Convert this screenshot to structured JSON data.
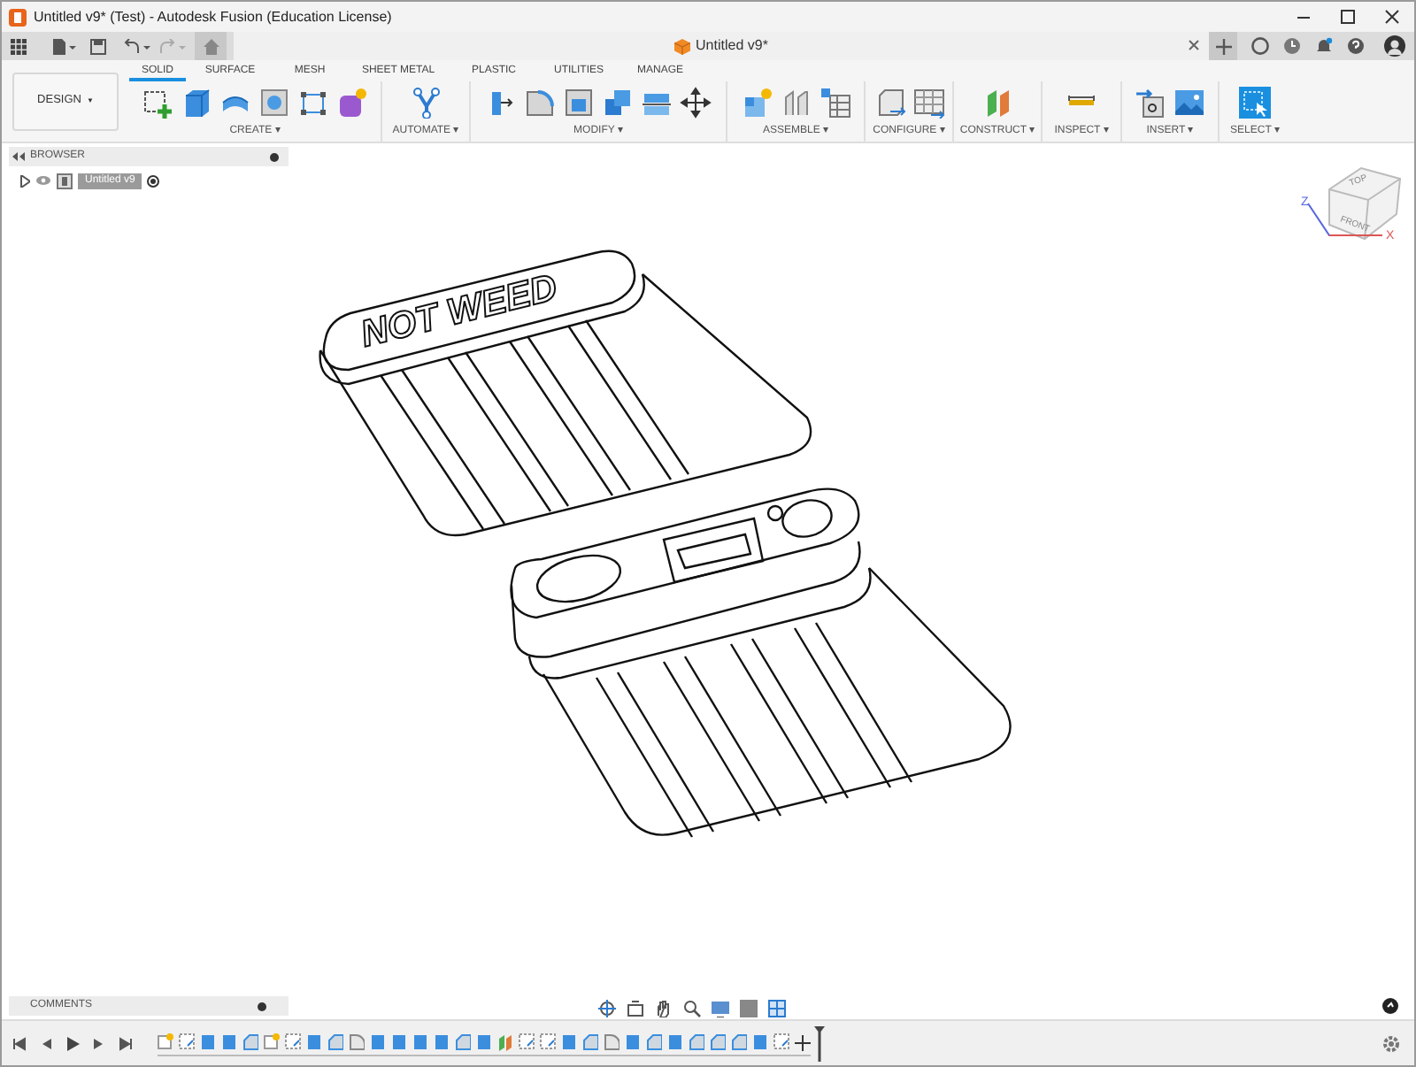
{
  "window": {
    "title": "Untitled v9* (Test) - Autodesk Fusion (Education License)"
  },
  "document_tab": {
    "title": "Untitled v9*"
  },
  "workspace_button": {
    "label": "DESIGN",
    "caret": "▼"
  },
  "ribbon_tabs": [
    {
      "label": "SOLID",
      "selected": true
    },
    {
      "label": "SURFACE",
      "selected": false
    },
    {
      "label": "MESH",
      "selected": false
    },
    {
      "label": "SHEET METAL",
      "selected": false
    },
    {
      "label": "PLASTIC",
      "selected": false
    },
    {
      "label": "UTILITIES",
      "selected": false
    },
    {
      "label": "MANAGE",
      "selected": false
    }
  ],
  "ribbon_groups": [
    {
      "label": "CREATE ▾"
    },
    {
      "label": "AUTOMATE ▾"
    },
    {
      "label": "MODIFY ▾"
    },
    {
      "label": "ASSEMBLE ▾"
    },
    {
      "label": "CONFIGURE ▾"
    },
    {
      "label": "CONSTRUCT ▾"
    },
    {
      "label": "INSPECT ▾"
    },
    {
      "label": "INSERT ▾"
    },
    {
      "label": "SELECT ▾"
    }
  ],
  "browser": {
    "title": "BROWSER",
    "items": [
      {
        "label": "Untitled v9",
        "expanded": false
      }
    ]
  },
  "model": {
    "engraving": "NOT WEED"
  },
  "view_cube": {
    "faces": [
      "TOP",
      "FRONT"
    ],
    "axes": [
      "Z",
      "X"
    ]
  },
  "comments": {
    "title": "COMMENTS"
  }
}
